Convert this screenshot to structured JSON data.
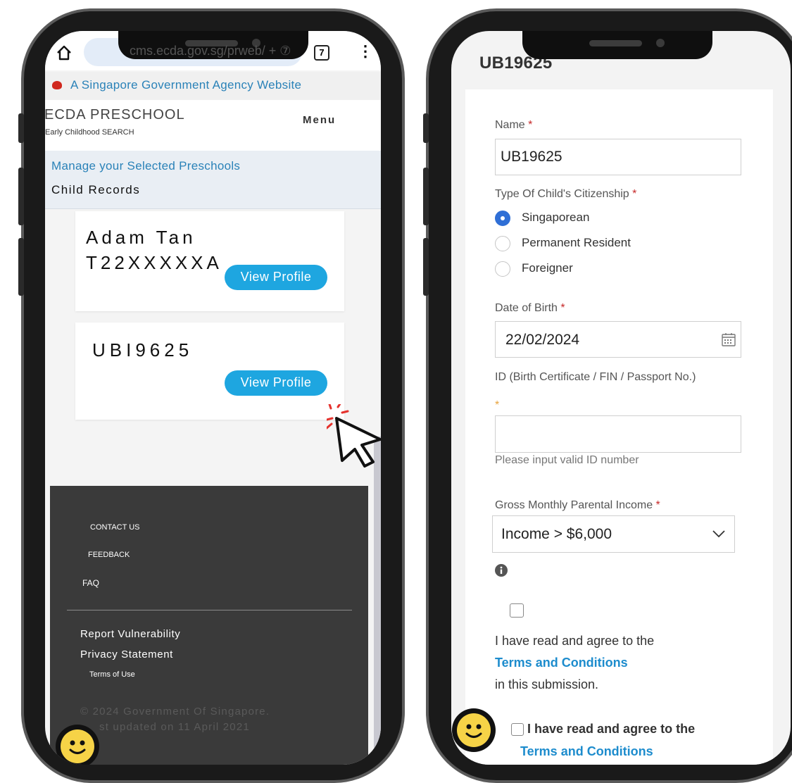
{
  "left_phone": {
    "browser": {
      "url": "cms.ecda.gov.sg/prweb/ + ⑦",
      "tab_count": "7"
    },
    "gov_banner": "A Singapore Government Agency Website",
    "header": {
      "brand": "ECDA PRESCHOOL",
      "brand_sub": "Early Childhood SEARCH",
      "menu": "Menu"
    },
    "sub_nav": {
      "link": "Manage your Selected Preschools",
      "current": "Child Records"
    },
    "children": [
      {
        "name": "Adam Tan",
        "id": "T22XXXXXA",
        "button": "View Profile"
      },
      {
        "name": "UBI9625",
        "button": "View Profile"
      }
    ],
    "footer": {
      "contact": "CONTACT US",
      "feedback": "FEEDBACK",
      "faq": "FAQ",
      "vulnerability": "Report Vulnerability",
      "privacy": "Privacy Statement",
      "terms": "Terms of Use",
      "copyright": "© 2024 Government Of Singapore.",
      "updated": "st updated on 11 April 2021"
    }
  },
  "right_phone": {
    "title": "UB19625",
    "name": {
      "label": "Name",
      "required": "*",
      "value": "UB19625"
    },
    "citizenship": {
      "label": "Type Of Child's Citizenship",
      "required": "*",
      "options": [
        "Singaporean",
        "Permanent Resident",
        "Foreigner"
      ],
      "selected": "Singaporean"
    },
    "dob": {
      "label": "Date of Birth",
      "required": "*",
      "value": "22/02/2024"
    },
    "id_field": {
      "label": "ID (Birth Certificate / FIN / Passport No.)",
      "required": "*",
      "value": "",
      "hint": "Please input valid ID number"
    },
    "income": {
      "label": "Gross Monthly Parental Income",
      "required": "*",
      "value": "Income > $6,000"
    },
    "consent": {
      "text": "I have read and agree to the",
      "link": "Terms and Conditions",
      "suffix": "in this submission."
    },
    "consent2": {
      "text": "I have read and agree to the",
      "link": "Terms and Conditions"
    }
  }
}
